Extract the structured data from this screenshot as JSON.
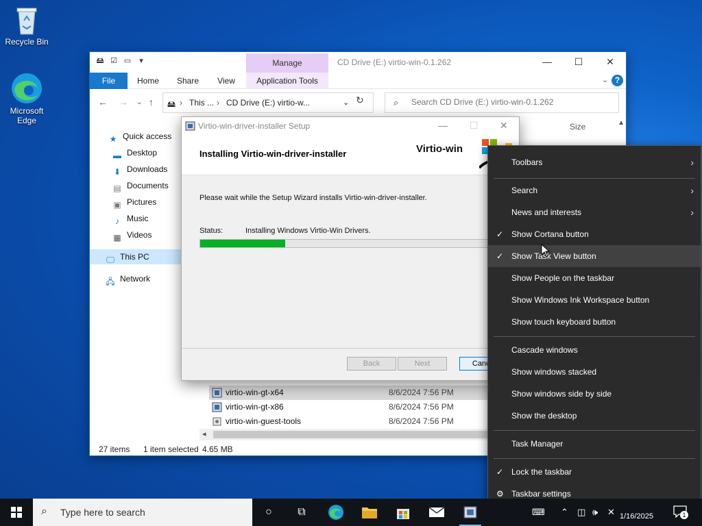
{
  "desktop": {
    "icons": [
      {
        "label": "Recycle Bin"
      },
      {
        "label": "Microsoft Edge"
      }
    ]
  },
  "explorer": {
    "title": "CD Drive (E:) virtio-win-0.1.262",
    "manage_label": "Manage",
    "tabs": {
      "file": "File",
      "home": "Home",
      "share": "Share",
      "view": "View",
      "app_tools": "Application Tools"
    },
    "address": {
      "seg1": "This ...",
      "seg2": "CD Drive (E:) virtio-w..."
    },
    "search_placeholder": "Search CD Drive (E:) virtio-win-0.1.262",
    "nav": {
      "quick_access": "Quick access",
      "desktop": "Desktop",
      "downloads": "Downloads",
      "documents": "Documents",
      "pictures": "Pictures",
      "music": "Music",
      "videos": "Videos",
      "this_pc": "This PC",
      "network": "Network"
    },
    "column_size": "Size",
    "files": [
      {
        "name": "virtio-win-gt-x64",
        "date": "8/6/2024 7:56 PM"
      },
      {
        "name": "virtio-win-gt-x86",
        "date": "8/6/2024 7:56 PM"
      },
      {
        "name": "virtio-win-guest-tools",
        "date": "8/6/2024 7:56 PM"
      }
    ],
    "status": {
      "items": "27 items",
      "selected": "1 item selected",
      "size": "4.65 MB"
    }
  },
  "setup": {
    "title": "Virtio-win-driver-installer Setup",
    "heading": "Installing Virtio-win-driver-installer",
    "brand": "Virtio-win",
    "message": "Please wait while the Setup Wizard installs Virtio-win-driver-installer.",
    "status_label": "Status:",
    "status_value": "Installing Windows Virtio-Win Drivers.",
    "progress_fraction": 0.27,
    "progress_color": "#06b025",
    "buttons": {
      "back": "Back",
      "next": "Next",
      "cancel": "Cancel"
    }
  },
  "context_menu": {
    "items": [
      {
        "label": "Toolbars"
      },
      {
        "label": "Search"
      },
      {
        "label": "News and interests"
      },
      {
        "label": "Show Cortana button",
        "check": "✓"
      },
      {
        "label": "Show Task View button",
        "check": "✓"
      },
      {
        "label": "Show People on the taskbar"
      },
      {
        "label": "Show Windows Ink Workspace button"
      },
      {
        "label": "Show touch keyboard button"
      },
      {
        "label": "Cascade windows"
      },
      {
        "label": "Show windows stacked"
      },
      {
        "label": "Show windows side by side"
      },
      {
        "label": "Show the desktop"
      },
      {
        "label": "Task Manager"
      },
      {
        "label": "Lock the taskbar",
        "check": "✓"
      },
      {
        "label": "Taskbar settings"
      }
    ]
  },
  "taskbar": {
    "search_placeholder": "Type here to search",
    "clock_date": "1/16/2025",
    "notification_count": "1"
  }
}
